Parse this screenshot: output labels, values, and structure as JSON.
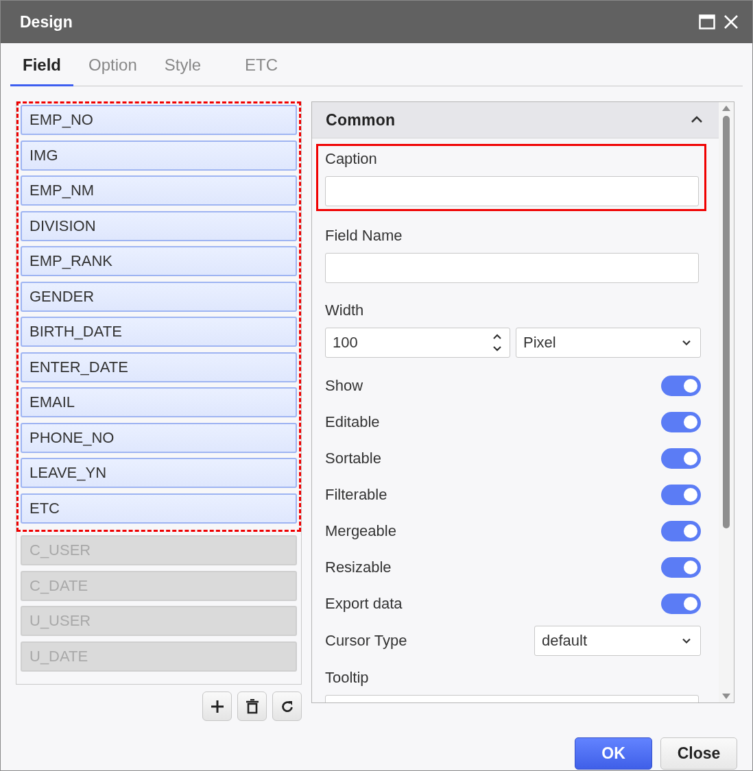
{
  "window": {
    "title": "Design"
  },
  "tabs": [
    {
      "label": "Field",
      "selected": true
    },
    {
      "label": "Option",
      "selected": false
    },
    {
      "label": "Style",
      "selected": false
    },
    {
      "label": "ETC",
      "selected": false
    }
  ],
  "field_groups": [
    {
      "highlighted": true,
      "items": [
        {
          "label": "EMP_NO",
          "enabled": true
        },
        {
          "label": "IMG",
          "enabled": true
        },
        {
          "label": "EMP_NM",
          "enabled": true
        },
        {
          "label": "DIVISION",
          "enabled": true
        },
        {
          "label": "EMP_RANK",
          "enabled": true
        },
        {
          "label": "GENDER",
          "enabled": true
        },
        {
          "label": "BIRTH_DATE",
          "enabled": true
        },
        {
          "label": "ENTER_DATE",
          "enabled": true
        },
        {
          "label": "EMAIL",
          "enabled": true
        },
        {
          "label": "PHONE_NO",
          "enabled": true
        },
        {
          "label": "LEAVE_YN",
          "enabled": true
        },
        {
          "label": "ETC",
          "enabled": true
        }
      ]
    },
    {
      "highlighted": false,
      "items": [
        {
          "label": "C_USER",
          "enabled": false
        },
        {
          "label": "C_DATE",
          "enabled": false
        },
        {
          "label": "U_USER",
          "enabled": false
        },
        {
          "label": "U_DATE",
          "enabled": false
        }
      ]
    }
  ],
  "section": {
    "title": "Common",
    "expanded": true,
    "properties": [
      {
        "kind": "text",
        "label": "Caption",
        "highlighted": true
      },
      {
        "kind": "text",
        "label": "Field Name",
        "highlighted": false
      },
      {
        "kind": "number",
        "label": "Width",
        "value": "100",
        "unit": "Pixel"
      },
      {
        "kind": "toggle",
        "label": "Show",
        "on": true
      },
      {
        "kind": "toggle",
        "label": "Editable",
        "on": true
      },
      {
        "kind": "toggle",
        "label": "Sortable",
        "on": true
      },
      {
        "kind": "toggle",
        "label": "Filterable",
        "on": true
      },
      {
        "kind": "toggle",
        "label": "Mergeable",
        "on": true
      },
      {
        "kind": "toggle",
        "label": "Resizable",
        "on": true
      },
      {
        "kind": "toggle",
        "label": "Export data",
        "on": true
      },
      {
        "kind": "select",
        "label": "Cursor Type",
        "value": "default"
      },
      {
        "kind": "text",
        "label": "Tooltip",
        "highlighted": false
      }
    ]
  },
  "buttons": [
    {
      "label": "OK",
      "kind": "primary"
    },
    {
      "label": "Close",
      "kind": "secondary"
    }
  ]
}
